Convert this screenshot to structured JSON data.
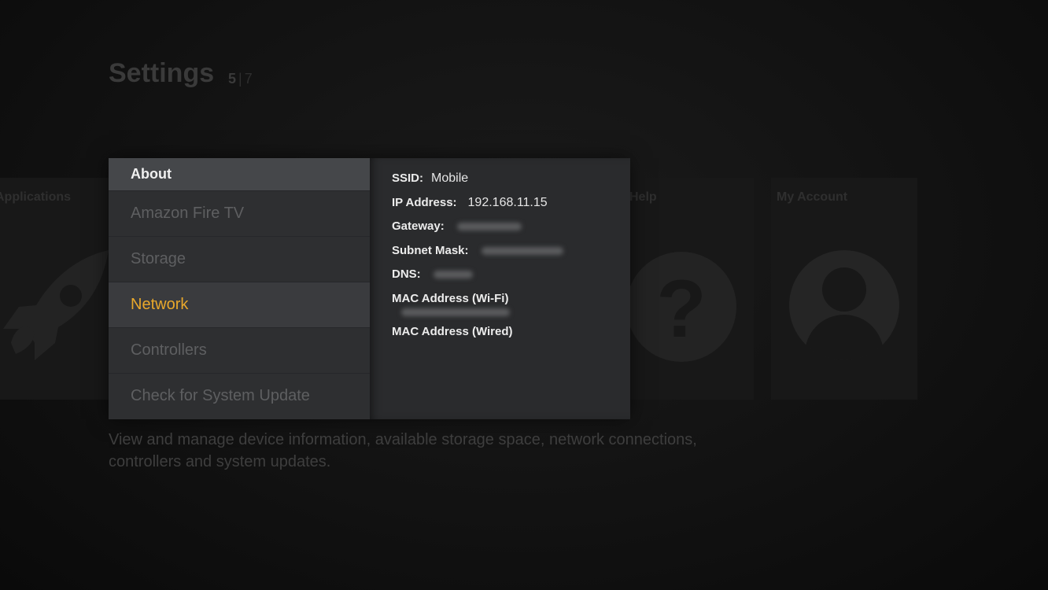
{
  "header": {
    "title": "Settings",
    "page_current": "5",
    "page_separator": "|",
    "page_total": "7"
  },
  "background_tiles": [
    {
      "label": "Applications",
      "icon": "rocket-icon"
    },
    {
      "label": "Help",
      "icon": "question-icon"
    },
    {
      "label": "My Account",
      "icon": "user-avatar-icon"
    }
  ],
  "menu": {
    "header": "About",
    "items": [
      {
        "label": "Amazon Fire TV"
      },
      {
        "label": "Storage"
      },
      {
        "label": "Network",
        "selected": true
      },
      {
        "label": "Controllers"
      },
      {
        "label": "Check for System Update"
      }
    ]
  },
  "details": {
    "ssid_label": "SSID:",
    "ssid_value": "Mobile",
    "ip_label": "IP Address:",
    "ip_value": "192.168.11.15",
    "gateway_label": "Gateway:",
    "subnet_label": "Subnet Mask:",
    "dns_label": "DNS:",
    "mac_wifi_label": "MAC Address (Wi-Fi)",
    "mac_wired_label": "MAC Address (Wired)"
  },
  "description": "View and manage device information, available storage space, network connections, controllers and system updates.",
  "colors": {
    "selected_text": "#e9a82b",
    "panel_menu_bg": "#2e2f31",
    "panel_header_bg": "#45474a",
    "details_bg": "#2a2b2d"
  }
}
